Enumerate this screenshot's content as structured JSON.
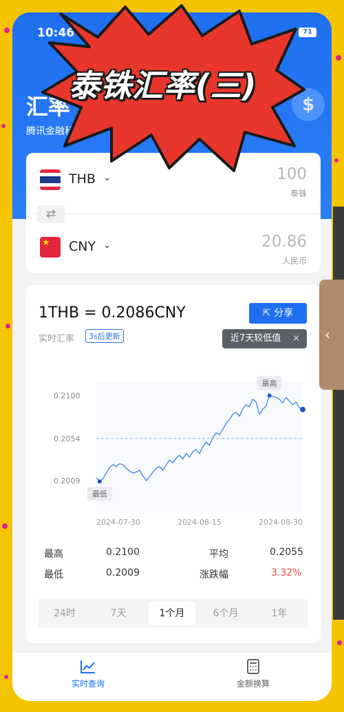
{
  "status": {
    "time": "10:46",
    "battery": "71"
  },
  "banner": {
    "text": "泰铢汇率(三)"
  },
  "app": {
    "title": "汇率",
    "subtitle": "腾讯金融科技",
    "coin_symbol": "$"
  },
  "converter": {
    "from": {
      "code": "THB",
      "amount": "100",
      "name": "泰铢"
    },
    "to": {
      "code": "CNY",
      "amount": "20.86",
      "name": "人民币"
    },
    "swap_icon": "swap-arrows-icon"
  },
  "rate": {
    "headline": "1THB = 0.2086CNY",
    "live_label": "实时汇率",
    "update_badge": "3s后更新",
    "share_label": "分享",
    "tooltip": "近7天较低值",
    "tooltip_close": "×"
  },
  "chart_data": {
    "type": "line",
    "yticks": [
      "0.2100",
      "0.2054",
      "0.2009"
    ],
    "xticks": [
      "2024-07-30",
      "2024-08-15",
      "2024-08-30"
    ],
    "ylim": [
      0.1975,
      0.2115
    ],
    "high_label": "最高",
    "low_label": "最低",
    "avg_line": 0.2054,
    "series": [
      {
        "values": [
          0.2012,
          0.2008,
          0.2011,
          0.2017,
          0.2023,
          0.2026,
          0.2024,
          0.2027,
          0.2026,
          0.2022,
          0.2019,
          0.2017,
          0.2018,
          0.202,
          0.2014,
          0.2009,
          0.2013,
          0.2018,
          0.2022,
          0.2024,
          0.202,
          0.2026,
          0.2031,
          0.2028,
          0.2033,
          0.2036,
          0.2032,
          0.2038,
          0.2034,
          0.204,
          0.2042,
          0.2038,
          0.2045,
          0.205,
          0.2047,
          0.2055,
          0.206,
          0.2058,
          0.2064,
          0.207,
          0.2074,
          0.208,
          0.2082,
          0.2078,
          0.2086,
          0.209,
          0.2088,
          0.2096,
          0.2093,
          0.208,
          0.2085,
          0.2089,
          0.21,
          0.2099,
          0.2098,
          0.2096,
          0.2092,
          0.2098,
          0.2094,
          0.209,
          0.2093,
          0.2087,
          0.2085
        ]
      }
    ]
  },
  "stats": {
    "high_label": "最高",
    "high_value": "0.2100",
    "avg_label": "平均",
    "avg_value": "0.2055",
    "low_label": "最低",
    "low_value": "0.2009",
    "change_label": "涨跌幅",
    "change_value": "3.32%",
    "change_color": "#e5484d"
  },
  "periods": [
    "24时",
    "7天",
    "1个月",
    "6个月",
    "1年"
  ],
  "active_period": "1个月",
  "nav": {
    "live": "实时查询",
    "convert": "金额换算"
  },
  "colors": {
    "accent": "#1f6ff0",
    "line": "#3a86e8",
    "frame": "#f5c400"
  }
}
